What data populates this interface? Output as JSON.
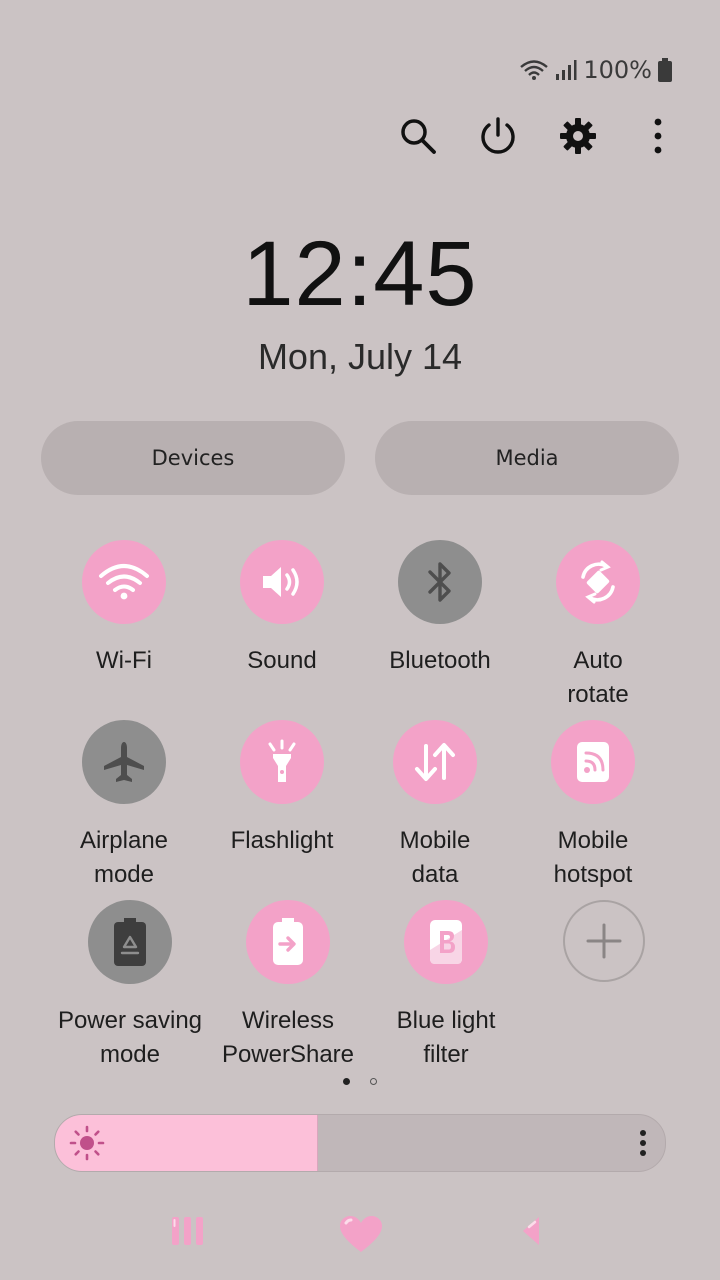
{
  "status_bar": {
    "battery_text": "100%",
    "icons": [
      "wifi-icon",
      "signal-icon",
      "battery-icon"
    ]
  },
  "top_actions": [
    "search-icon",
    "power-icon",
    "gear-icon",
    "more-vertical-icon"
  ],
  "clock": {
    "time": "12:45",
    "date": "Mon, July 14"
  },
  "buttons": {
    "devices": "Devices",
    "media": "Media"
  },
  "tiles": [
    {
      "label": "Wi-Fi",
      "icon": "wifi-icon",
      "state": "on"
    },
    {
      "label": "Sound",
      "icon": "speaker-icon",
      "state": "on"
    },
    {
      "label": "Bluetooth",
      "icon": "bluetooth-icon",
      "state": "off"
    },
    {
      "label": "Auto\nrotate",
      "icon": "auto-rotate-icon",
      "state": "on"
    },
    {
      "label": "Airplane\nmode",
      "icon": "airplane-icon",
      "state": "off"
    },
    {
      "label": "Flashlight",
      "icon": "flashlight-icon",
      "state": "on"
    },
    {
      "label": "Mobile\ndata",
      "icon": "mobile-data-icon",
      "state": "on"
    },
    {
      "label": "Mobile\nhotspot",
      "icon": "hotspot-icon",
      "state": "on"
    },
    {
      "label": "Power saving\nmode",
      "icon": "power-saving-icon",
      "state": "off"
    },
    {
      "label": "Wireless\nPowerShare",
      "icon": "wireless-powershare-icon",
      "state": "on"
    },
    {
      "label": "Blue light\nfilter",
      "icon": "blue-light-filter-icon",
      "state": "on"
    },
    {
      "label": "",
      "icon": "add-icon",
      "state": "add"
    }
  ],
  "pages": {
    "count": 2,
    "current": 1
  },
  "brightness": {
    "level": 0.43
  },
  "nav_bar": [
    "recent-apps-icon",
    "home-heart-icon",
    "back-icon"
  ],
  "colors": {
    "background": "#cbc3c4",
    "tile_on": "#f3a2c8",
    "tile_off": "#8e8e8e",
    "brightness_fill": "#fcc0d9",
    "accent": "#f07db3"
  }
}
